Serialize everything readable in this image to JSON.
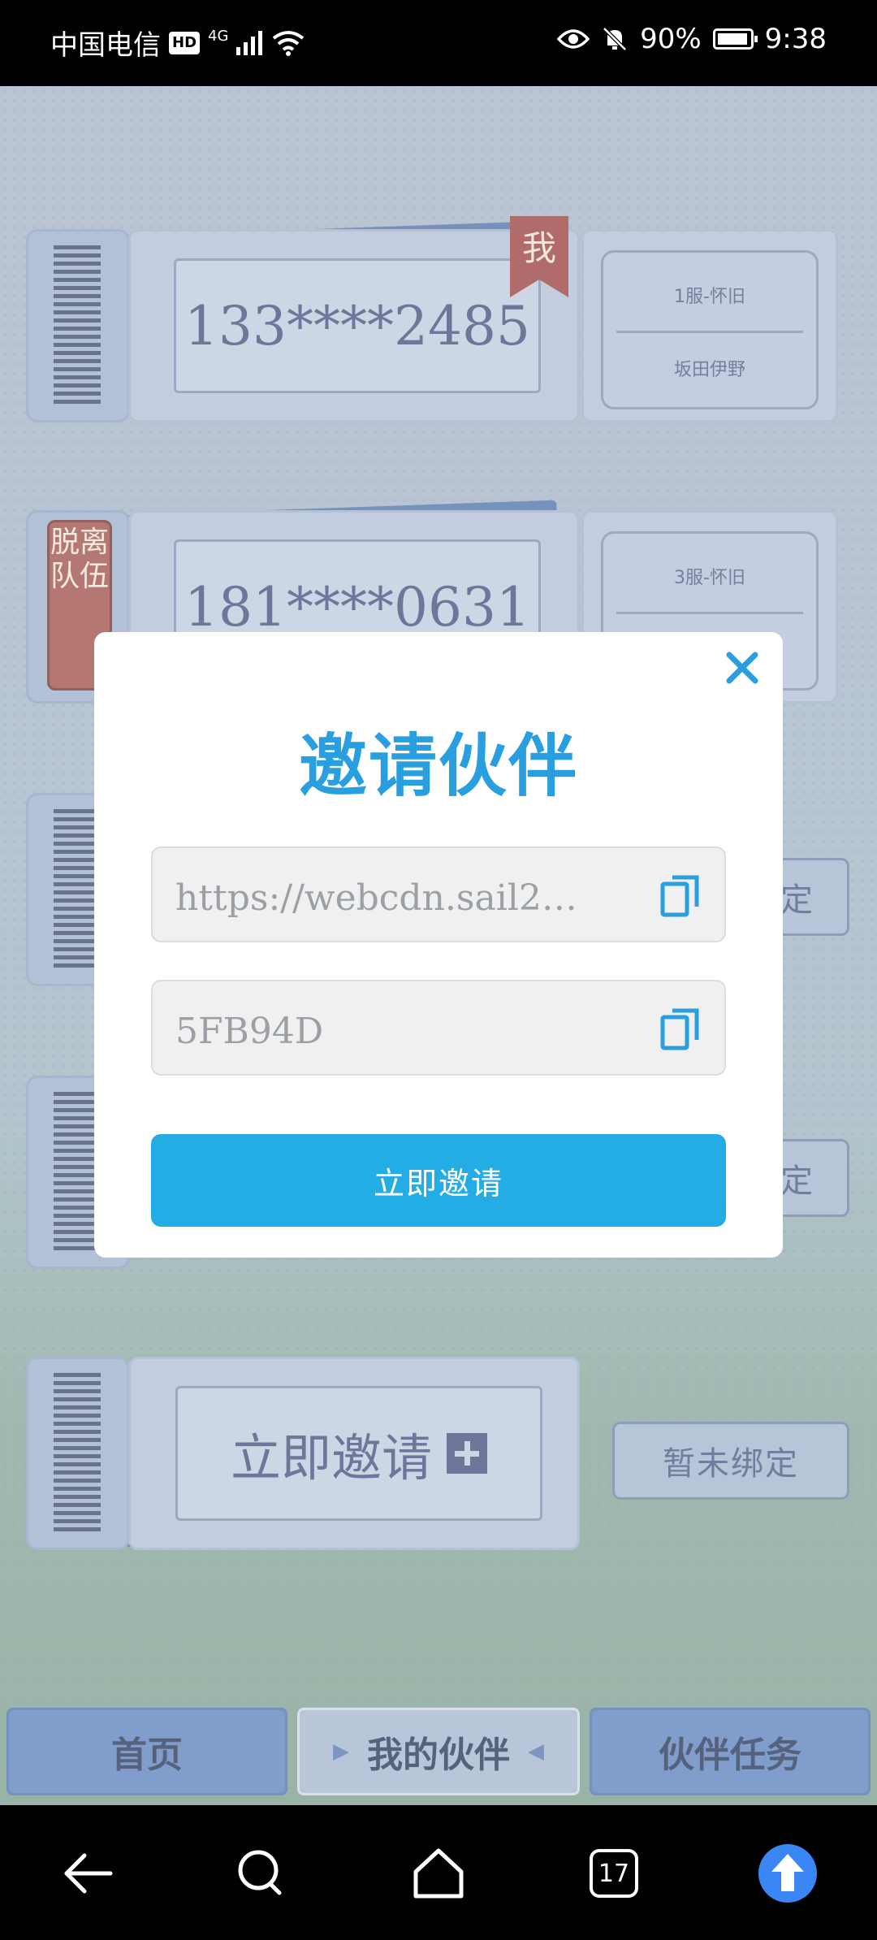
{
  "status_bar": {
    "carrier": "中国电信",
    "hd": "HD",
    "network": "4G",
    "battery": "90%",
    "time": "9:38"
  },
  "tickets": [
    {
      "phone": "133****2485",
      "server": "1服-怀旧",
      "name": "坂田伊野",
      "badge": "我"
    },
    {
      "phone": "181****0631",
      "server": "3服-怀旧",
      "badge": "脱离队伍"
    }
  ],
  "unbound_pills": [
    "定",
    "定",
    "暂未绑定"
  ],
  "invite_card": {
    "label": "立即邀请"
  },
  "tabs": {
    "home": "首页",
    "partners": "我的伙伴",
    "tasks": "伙伴任务"
  },
  "modal": {
    "title": "邀请伙伴",
    "invite_link": "https://webcdn.sail2w…",
    "invite_code": "5FB94D",
    "invite_button": "立即邀请",
    "accent_color": "#24ace4"
  },
  "nav": {
    "recent_count": "17"
  }
}
